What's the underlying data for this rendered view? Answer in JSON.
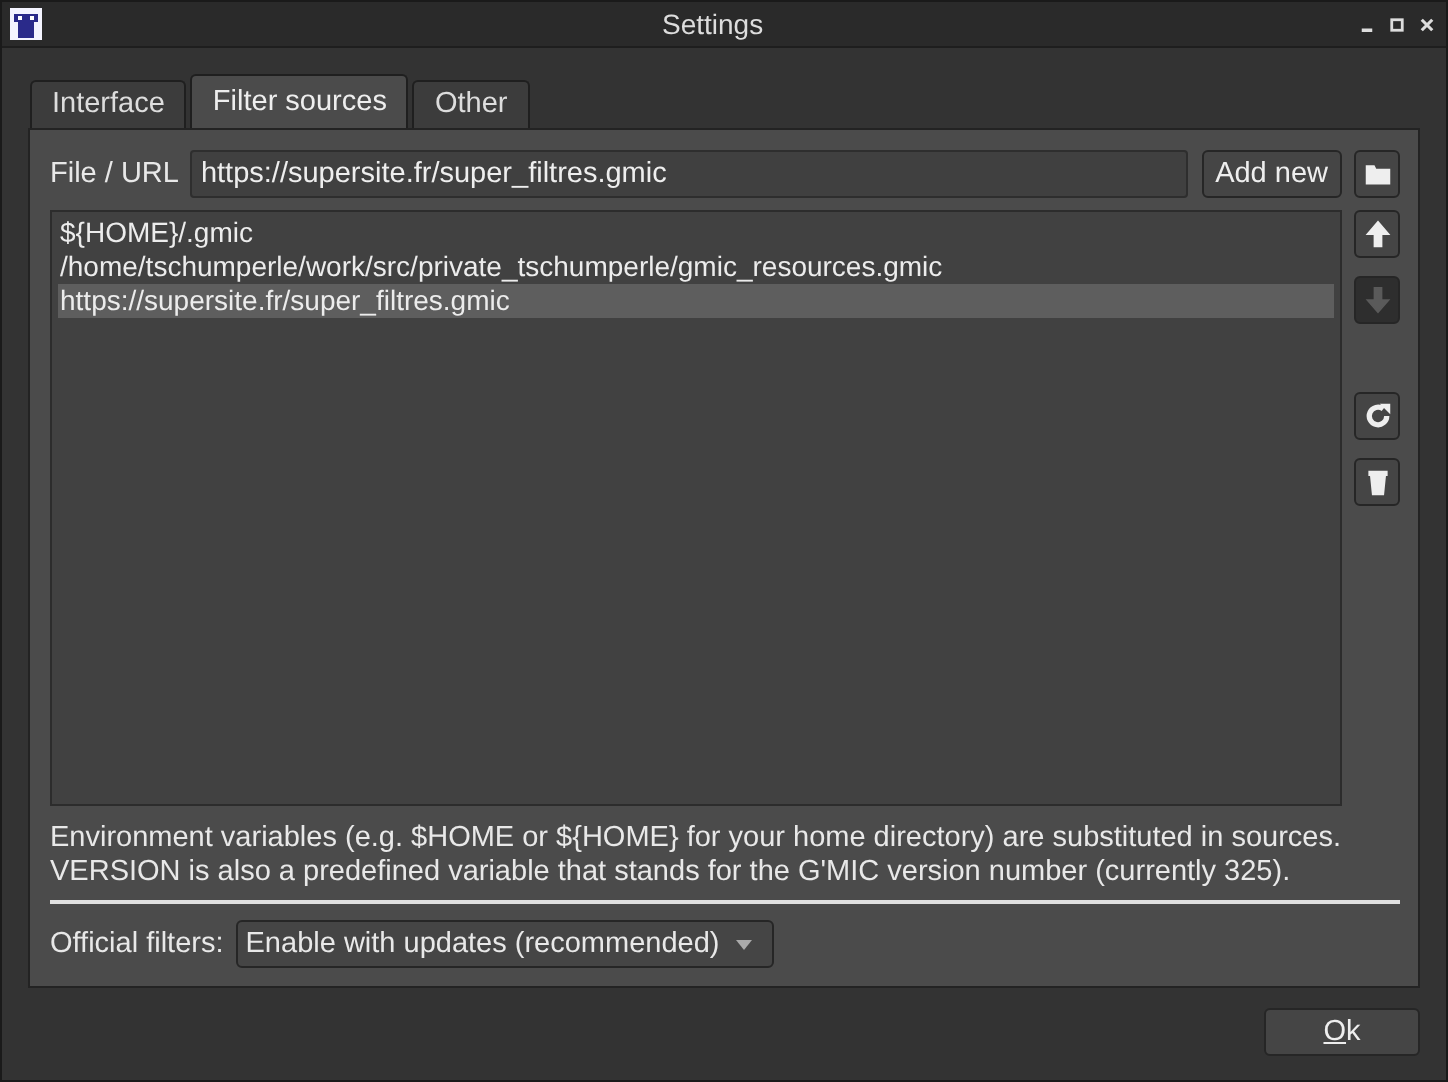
{
  "window": {
    "title": "Settings"
  },
  "tabs": [
    {
      "label": "Interface",
      "selected": false
    },
    {
      "label": "Filter sources",
      "selected": true
    },
    {
      "label": "Other",
      "selected": false
    }
  ],
  "source_field": {
    "label": "File / URL",
    "value": "https://supersite.fr/super_filtres.gmic"
  },
  "add_button": "Add new",
  "sources": [
    {
      "text": "${HOME}/.gmic",
      "selected": false
    },
    {
      "text": "/home/tschumperle/work/src/private_tschumperle/gmic_resources.gmic",
      "selected": false
    },
    {
      "text": "https://supersite.fr/super_filtres.gmic",
      "selected": true
    }
  ],
  "side_buttons": [
    {
      "kind": "up",
      "disabled": false
    },
    {
      "kind": "down",
      "disabled": true
    },
    {
      "kind": "reload",
      "disabled": false
    },
    {
      "kind": "delete",
      "disabled": false
    }
  ],
  "note": [
    "Environment variables (e.g. $HOME or ${HOME} for your home directory) are substituted in sources.",
    "VERSION is also a predefined variable that stands for the G'MIC version number (currently 325)."
  ],
  "official_filters": {
    "label": "Official filters:",
    "value": "Enable with updates (recommended)"
  },
  "ok_button": "Ok"
}
